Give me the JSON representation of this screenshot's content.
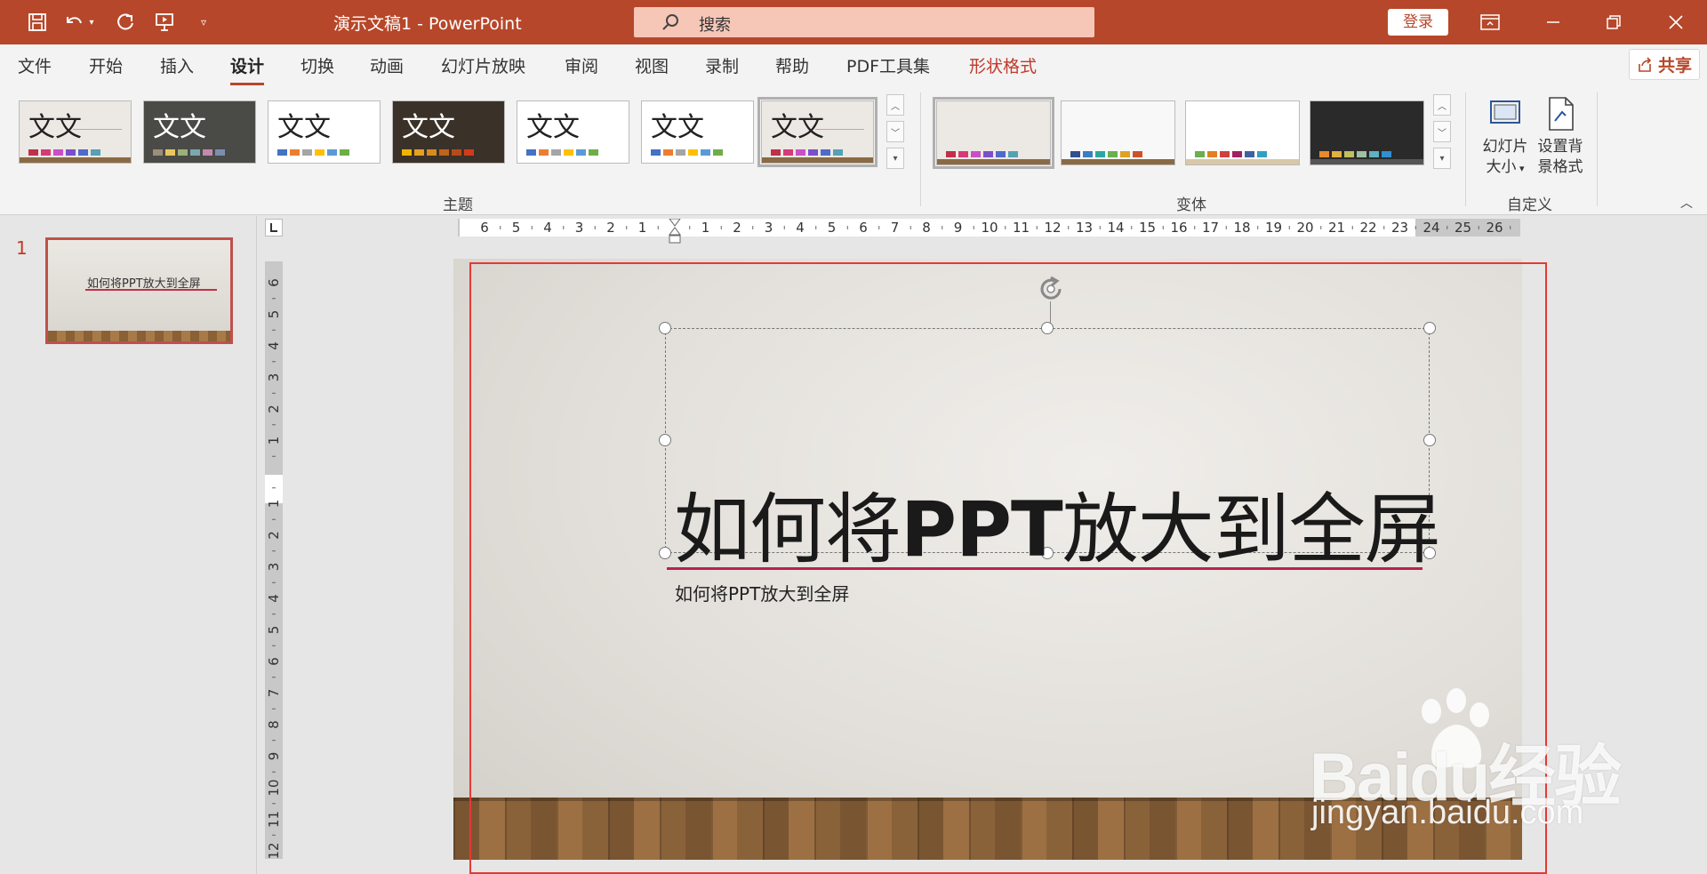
{
  "title_bar": {
    "doc_title": "演示文稿1  -  PowerPoint",
    "search_label": "搜索",
    "login_label": "登录"
  },
  "tabs": [
    {
      "label": "文件"
    },
    {
      "label": "开始"
    },
    {
      "label": "插入"
    },
    {
      "label": "设计",
      "active": true
    },
    {
      "label": "切换"
    },
    {
      "label": "动画"
    },
    {
      "label": "幻灯片放映"
    },
    {
      "label": "审阅"
    },
    {
      "label": "视图"
    },
    {
      "label": "录制"
    },
    {
      "label": "帮助"
    },
    {
      "label": "PDF工具集"
    },
    {
      "label": "形状格式",
      "contextual": true
    }
  ],
  "share_label": "共享",
  "ribbon": {
    "themes_group_label": "主题",
    "variants_group_label": "变体",
    "customize_group_label": "自定义",
    "theme_sample_text": "文文",
    "slide_size_label_1": "幻灯片",
    "slide_size_label_2": "大小",
    "format_bg_label_1": "设置背",
    "format_bg_label_2": "景格式",
    "themes": [
      {
        "bg": "#ece9e4",
        "fg": "#222",
        "swatches": [
          "#c0304a",
          "#d63a78",
          "#c94fc8",
          "#7b4fc9",
          "#4f6bc9",
          "#57a0b5"
        ]
      },
      {
        "bg": "#4a4a46",
        "fg": "#fff",
        "swatches": [
          "#9a8f7a",
          "#e8c75c",
          "#9cb07a",
          "#7aa8b0",
          "#c28ab0",
          "#7a8fb0"
        ]
      },
      {
        "bg": "#ffffff",
        "fg": "#222",
        "swatches": [
          "#4472c4",
          "#ed7d31",
          "#a5a5a5",
          "#ffc000",
          "#5b9bd5",
          "#70ad47"
        ]
      },
      {
        "bg": "#3a3128",
        "fg": "#fff",
        "swatches": [
          "#f0b400",
          "#e8a020",
          "#d98a1e",
          "#c0641c",
          "#b84a1a",
          "#d03c1a"
        ]
      },
      {
        "bg": "#ffffff",
        "fg": "#222",
        "swatches": [
          "#4472c4",
          "#ed7d31",
          "#a5a5a5",
          "#ffc000",
          "#5b9bd5",
          "#70ad47"
        ]
      },
      {
        "bg": "#ffffff",
        "fg": "#222",
        "swatches": [
          "#4472c4",
          "#ed7d31",
          "#a5a5a5",
          "#ffc000",
          "#5b9bd5",
          "#70ad47"
        ]
      },
      {
        "bg": "#ece9e4",
        "fg": "#222",
        "swatches": [
          "#c0304a",
          "#d63a78",
          "#c94fc8",
          "#7b4fc9",
          "#4f6bc9",
          "#57a0b5"
        ],
        "selected": true
      }
    ],
    "variants": [
      {
        "bg": "#ece9e4",
        "swatches": [
          "#c0304a",
          "#d63a78",
          "#c94fc8",
          "#7b4fc9",
          "#4f6bc9",
          "#57a0b5"
        ]
      },
      {
        "bg": "#f8f8f8",
        "swatches": [
          "#2f4f8f",
          "#3a7fbf",
          "#2aa8a0",
          "#6ab04c",
          "#e0a020",
          "#d0502a"
        ]
      },
      {
        "bg": "#ffffff",
        "swatches": [
          "#6ab04c",
          "#e08020",
          "#d04040",
          "#a02060",
          "#4060a0",
          "#30a0c0"
        ]
      },
      {
        "bg": "#2a2a2a",
        "swatches": [
          "#e88a2a",
          "#e0b040",
          "#c0c060",
          "#a0c0a0",
          "#60b0c0",
          "#3090d0"
        ]
      }
    ]
  },
  "slide_panel": {
    "slide_number": "1",
    "thumb_title": "如何将PPT放大到全屏"
  },
  "h_ruler_labels": [
    "6",
    "5",
    "4",
    "3",
    "2",
    "1",
    "",
    "1",
    "2",
    "3",
    "4",
    "5",
    "6",
    "7",
    "8",
    "9",
    "10",
    "11",
    "12",
    "13",
    "14",
    "15",
    "16",
    "17",
    "18",
    "19",
    "20",
    "21",
    "22",
    "23",
    "24",
    "25",
    "26"
  ],
  "v_ruler_labels": [
    "6",
    "5",
    "4",
    "3",
    "2",
    "1",
    "",
    "1",
    "2",
    "3",
    "4",
    "5",
    "6",
    "7",
    "8",
    "9",
    "10",
    "11",
    "12"
  ],
  "slide": {
    "title_pre": "如何将",
    "title_bold": "PPT",
    "title_post": "放大到全屏",
    "subtitle": "如何将PPT放大到全屏"
  },
  "watermark": {
    "logo": "Baidu经验",
    "url": "jingyan.baidu.com"
  },
  "colors": {
    "accent": "#b7472a",
    "title_underline": "#b8234a",
    "highlight_frame": "#e53935"
  }
}
